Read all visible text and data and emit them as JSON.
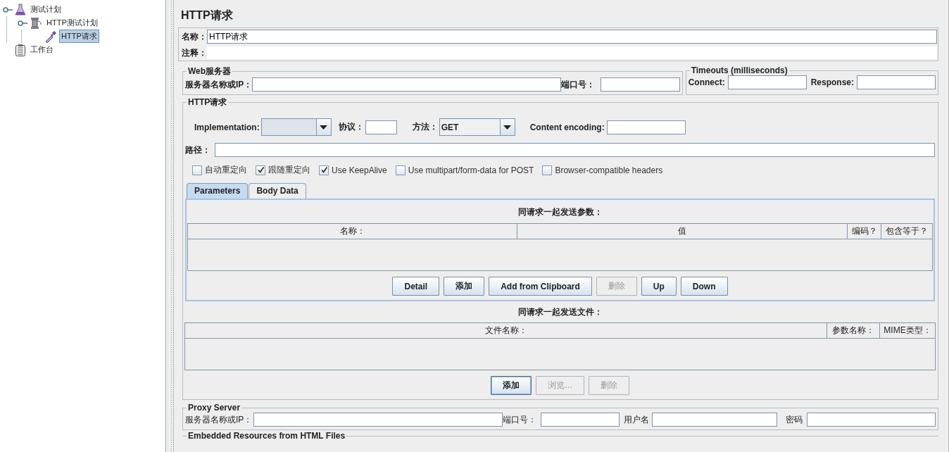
{
  "tree": [
    {
      "label": "测试计划",
      "kind": "plan",
      "selected": false,
      "expanded": true,
      "children": [
        {
          "label": "HTTP测试计划",
          "kind": "group",
          "selected": false,
          "expanded": true,
          "children": [
            {
              "label": "HTTP请求",
              "kind": "sampler",
              "selected": true
            }
          ]
        }
      ]
    },
    {
      "label": "工作台",
      "kind": "workbench",
      "selected": false
    }
  ],
  "panel": {
    "title": "HTTP请求"
  },
  "name_field": {
    "label": "名称：",
    "value": "HTTP请求"
  },
  "comment_field": {
    "label": "注释："
  },
  "web_server": {
    "legend": "Web服务器",
    "server_label": "服务器名称或IP：",
    "port_label": "端口号："
  },
  "timeouts": {
    "legend": "Timeouts (milliseconds)",
    "connect_label": "Connect:",
    "response_label": "Response:"
  },
  "http_request": {
    "legend": "HTTP请求",
    "implementation_label": "Implementation:",
    "protocol_label": "协议：",
    "method_label": "方法：",
    "method_value": "GET",
    "encoding_label": "Content encoding:",
    "path_label": "路径：",
    "options": [
      {
        "label": "自动重定向",
        "checked": false
      },
      {
        "label": "跟随重定向",
        "checked": true
      },
      {
        "label": "Use KeepAlive",
        "checked": true
      },
      {
        "label": "Use multipart/form-data for POST",
        "checked": false
      },
      {
        "label": "Browser-compatible headers",
        "checked": false
      }
    ]
  },
  "tabs": [
    {
      "label": "Parameters",
      "selected": true
    },
    {
      "label": "Body Data",
      "selected": false
    }
  ],
  "parameters": {
    "caption": "同请求一起发送参数：",
    "columns": [
      "名称：",
      "值",
      "编码？",
      "包含等于？"
    ],
    "buttons": [
      {
        "label": "Detail",
        "disabled": false
      },
      {
        "label": "添加",
        "disabled": false
      },
      {
        "label": "Add from Clipboard",
        "disabled": false
      },
      {
        "label": "删除",
        "disabled": true
      },
      {
        "label": "Up",
        "disabled": false
      },
      {
        "label": "Down",
        "disabled": false
      }
    ]
  },
  "files": {
    "caption": "同请求一起发送文件：",
    "columns": [
      "文件名称：",
      "参数名称：",
      "MIME类型："
    ],
    "buttons": [
      {
        "label": "添加",
        "disabled": false
      },
      {
        "label": "浏览...",
        "disabled": true
      },
      {
        "label": "删除",
        "disabled": true
      }
    ]
  },
  "proxy": {
    "legend": "Proxy Server",
    "server_label": "服务器名称或IP：",
    "port_label": "端口号：",
    "user_label": "用户名",
    "password_label": "密码"
  },
  "embedded": {
    "legend": "Embedded Resources from HTML Files"
  }
}
